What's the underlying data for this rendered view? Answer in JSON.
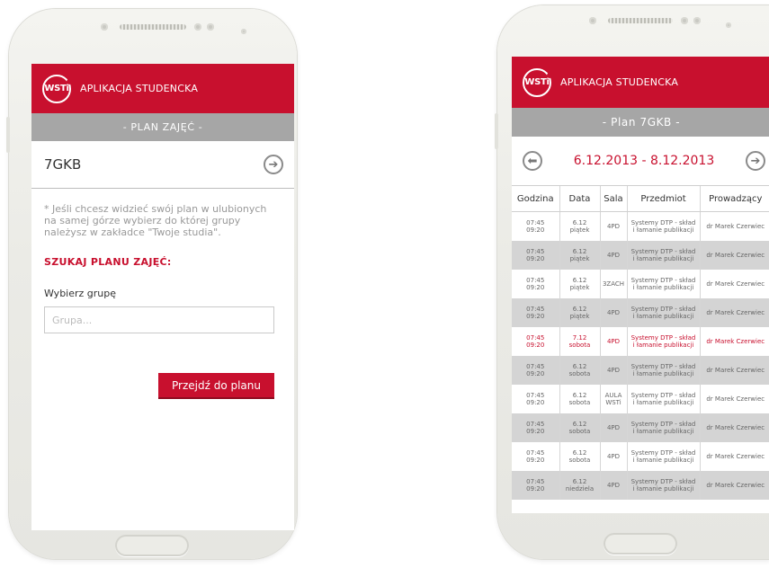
{
  "app": {
    "logo_text": "WSTi",
    "title": "APLIKACJA STUDENCKA"
  },
  "left": {
    "subtitle": "- PLAN ZAJĘĆ -",
    "group": "7GKB",
    "note": "* Jeśli chcesz widzieć swój plan w ulubionych na samej górze wybierz do której grupy należysz w zakładce \"Twoje studia\".",
    "search_heading": "SZUKAJ PLANU ZAJĘĆ:",
    "select_label": "Wybierz grupę",
    "input_placeholder": "Grupa...",
    "button": "Przejdź do planu"
  },
  "right": {
    "subtitle": "- Plan 7GKB -",
    "week_range": "6.12.2013 - 8.12.2013",
    "columns": [
      "Godzina",
      "Data",
      "Sala",
      "Przedmiot",
      "Prowadzący"
    ],
    "rows": [
      {
        "time_from": "07:45",
        "time_to": "09:20",
        "date": "6.12",
        "day": "piątek",
        "room": "4PD",
        "room2": "",
        "subject1": "Systemy DTP - skład",
        "subject2": "i łamanie publikacji",
        "teacher": "dr Marek Czerwiec",
        "style": "white"
      },
      {
        "time_from": "07:45",
        "time_to": "09:20",
        "date": "6.12",
        "day": "piątek",
        "room": "4PD",
        "room2": "",
        "subject1": "Systemy DTP - skład",
        "subject2": "i łamanie publikacji",
        "teacher": "dr Marek Czerwiec",
        "style": "shaded"
      },
      {
        "time_from": "07:45",
        "time_to": "09:20",
        "date": "6.12",
        "day": "piątek",
        "room": "3ZACH",
        "room2": "",
        "subject1": "Systemy DTP - skład",
        "subject2": "i łamanie publikacji",
        "teacher": "dr Marek Czerwiec",
        "style": "white"
      },
      {
        "time_from": "07:45",
        "time_to": "09:20",
        "date": "6.12",
        "day": "piątek",
        "room": "4PD",
        "room2": "",
        "subject1": "Systemy DTP - skład",
        "subject2": "i łamanie publikacji",
        "teacher": "dr Marek Czerwiec",
        "style": "shaded"
      },
      {
        "time_from": "07:45",
        "time_to": "09:20",
        "date": "7.12",
        "day": "sobota",
        "room": "4PD",
        "room2": "",
        "subject1": "Systemy DTP - skład",
        "subject2": "i łamanie publikacji",
        "teacher": "dr Marek Czerwiec",
        "style": "hl"
      },
      {
        "time_from": "07:45",
        "time_to": "09:20",
        "date": "6.12",
        "day": "sobota",
        "room": "4PD",
        "room2": "",
        "subject1": "Systemy DTP - skład",
        "subject2": "i łamanie publikacji",
        "teacher": "dr Marek Czerwiec",
        "style": "shaded"
      },
      {
        "time_from": "07:45",
        "time_to": "09:20",
        "date": "6.12",
        "day": "sobota",
        "room": "AULA",
        "room2": "WSTi",
        "subject1": "Systemy DTP - skład",
        "subject2": "i łamanie publikacji",
        "teacher": "dr Marek Czerwiec",
        "style": "white"
      },
      {
        "time_from": "07:45",
        "time_to": "09:20",
        "date": "6.12",
        "day": "sobota",
        "room": "4PD",
        "room2": "",
        "subject1": "Systemy DTP - skład",
        "subject2": "i łamanie publikacji",
        "teacher": "dr Marek Czerwiec",
        "style": "shaded"
      },
      {
        "time_from": "07:45",
        "time_to": "09:20",
        "date": "6.12",
        "day": "sobota",
        "room": "4PD",
        "room2": "",
        "subject1": "Systemy DTP - skład",
        "subject2": "i łamanie publikacji",
        "teacher": "dr Marek Czerwiec",
        "style": "white"
      },
      {
        "time_from": "07:45",
        "time_to": "09:20",
        "date": "6.12",
        "day": "niedziela",
        "room": "4PD",
        "room2": "",
        "subject1": "Systemy DTP - skład",
        "subject2": "i łamanie publikacji",
        "teacher": "dr Marek Czerwiec",
        "style": "shaded"
      }
    ]
  },
  "colors": {
    "brand_red": "#c8102e",
    "subbar_gray": "#a6a6a6",
    "row_shade": "#d4d4d4"
  },
  "icons": {
    "next": "arrow-right-circle-icon",
    "prev": "arrow-left-circle-icon"
  }
}
